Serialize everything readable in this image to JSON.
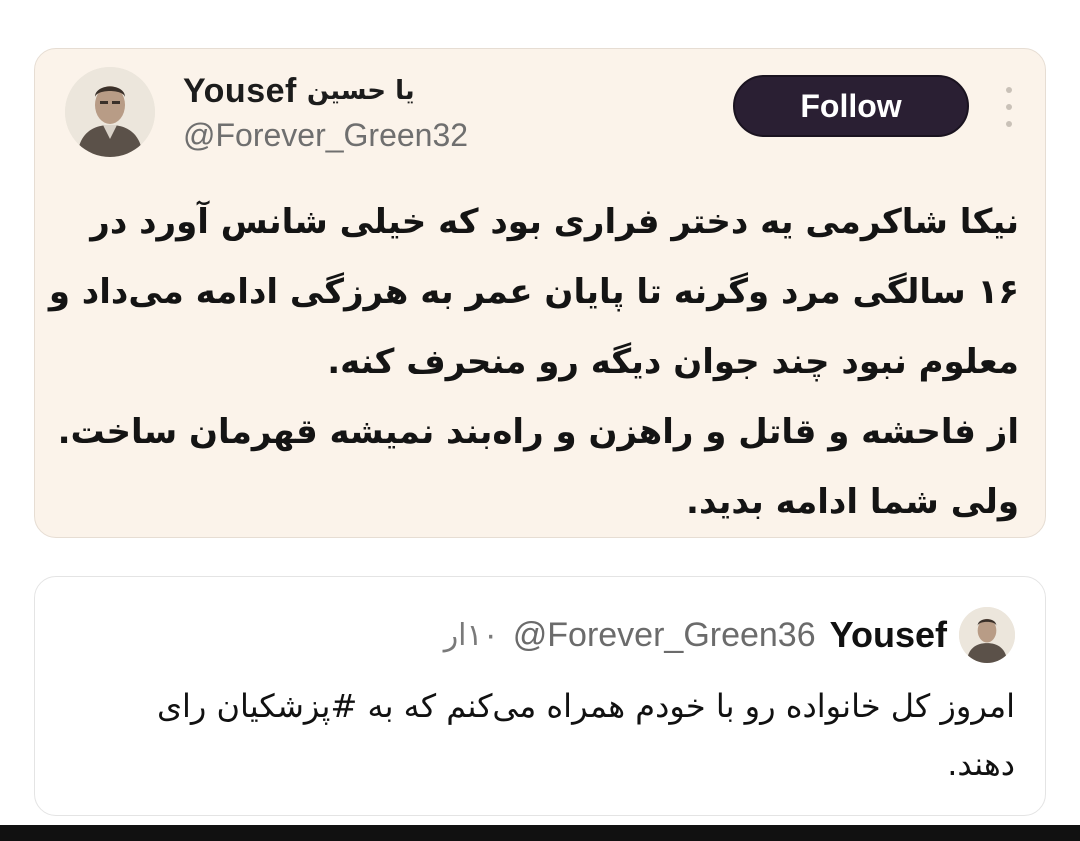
{
  "main_tweet": {
    "display_name_prefix": "یا حسین",
    "display_name": "Yousef",
    "handle": "@Forever_Green32",
    "follow_label": "Follow",
    "more_icon": "more-vertical-icon",
    "body_lines": [
      "نیکا شاکرمی یه دختر فراری بود که خیلی شانس آورد در",
      "۱۶ سالگی مرد وگرنه تا پایان عمر به هرزگی ادامه می‌داد و",
      "معلوم نبود چند جوان دیگه رو منحرف کنه.",
      "از فاحشه و قاتل و راهزن و راه‌بند نمیشه قهرمان ساخت.",
      "ولی شما ادامه بدید."
    ]
  },
  "quoted_tweet": {
    "display_name": "Yousef",
    "handle": "@Forever_Green36",
    "time": "۱۰ار",
    "body_lines": [
      "امروز کل خانواده رو با خودم همراه می‌کنم که به #پزشکیان رای",
      "دهند."
    ]
  },
  "colors": {
    "card_background": "#fbf3ea",
    "follow_button": "#2a1f33",
    "text": "#141414",
    "secondary_text": "#6f6f6f"
  }
}
